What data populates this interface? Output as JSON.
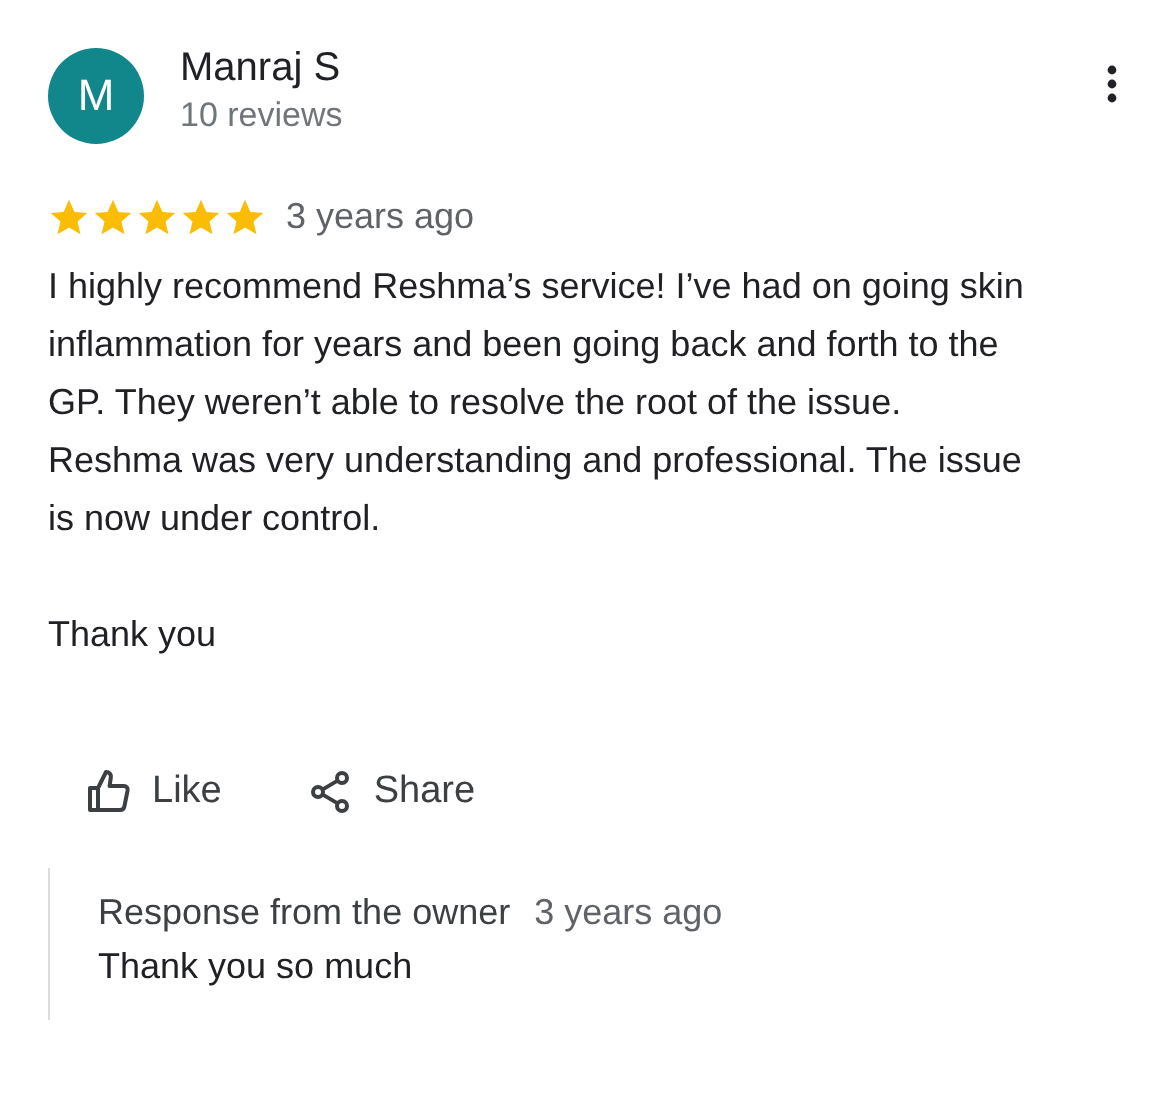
{
  "review": {
    "avatar_letter": "M",
    "author": "Manraj S",
    "meta": "10 reviews",
    "stars": 5,
    "time": "3 years ago",
    "paragraphs": [
      "I highly recommend Reshma’s service! I’ve had on going skin inflammation for years and been going back and forth to the GP. They weren’t able to resolve the root of the issue. Reshma was very understanding and professional. The issue is now under control.",
      "Thank you"
    ]
  },
  "actions": [
    {
      "kind": "like",
      "label": "Like"
    },
    {
      "kind": "share",
      "label": "Share"
    }
  ],
  "response": {
    "title": "Response from the owner",
    "time": "3 years ago",
    "text": "Thank you so much"
  }
}
